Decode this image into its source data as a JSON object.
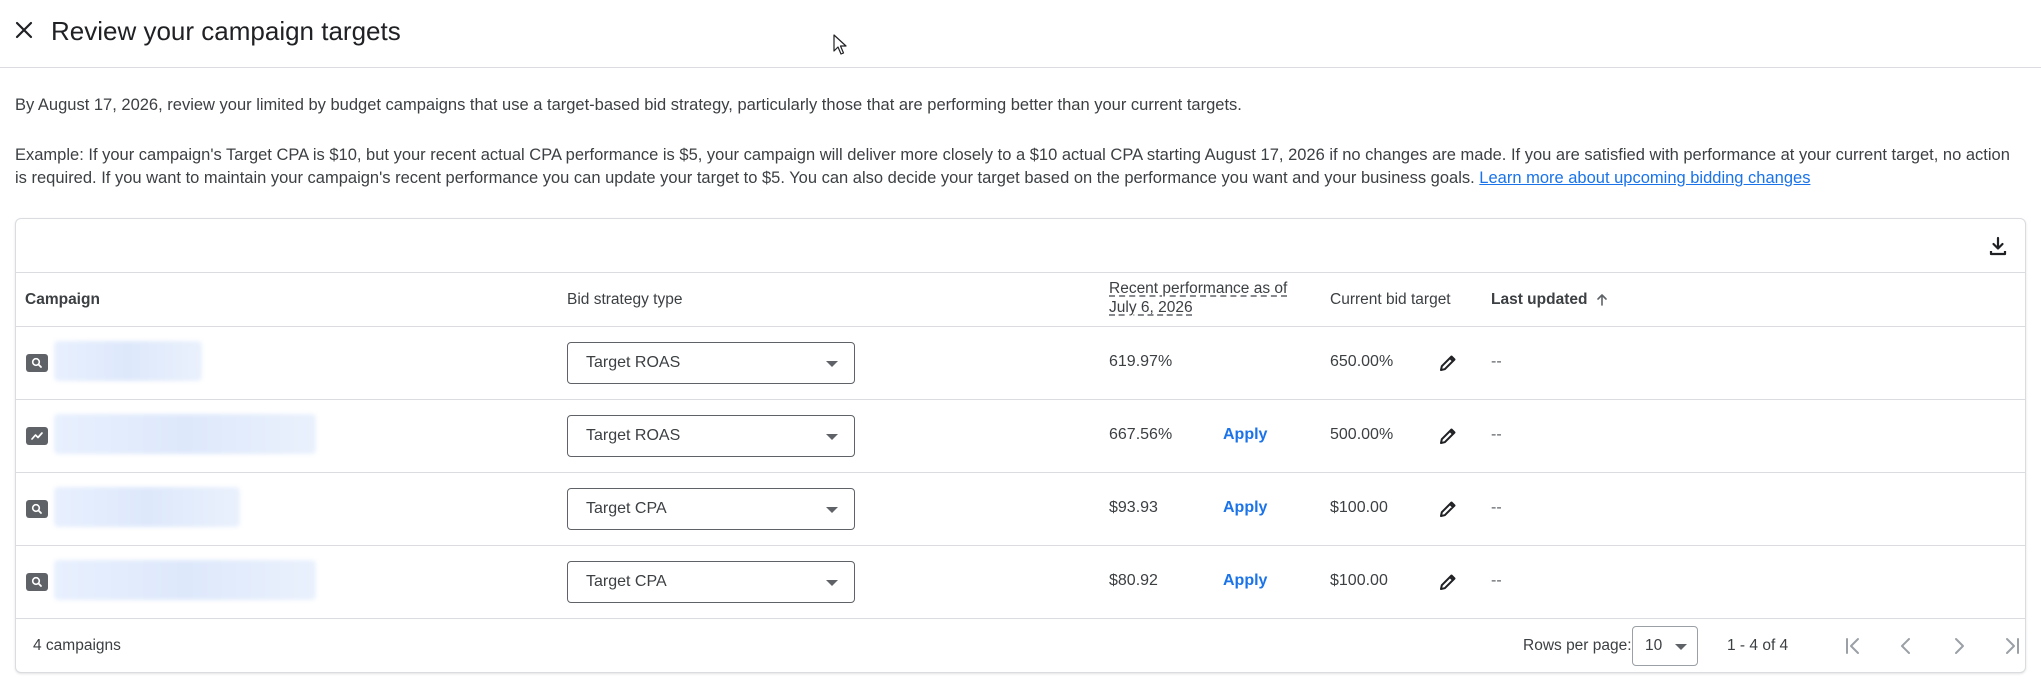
{
  "header": {
    "title": "Review your campaign targets",
    "close_icon": "close-icon"
  },
  "description": {
    "line1": "By August 17, 2026, review your limited by budget campaigns that use a target-based bid strategy, particularly those that are performing better than your current targets.",
    "line2": "Example: If your campaign's Target CPA is $10, but your recent actual CPA performance is $5, your campaign will deliver more closely to a $10 actual CPA starting August 17, 2026 if no changes are made. If you are satisfied with performance at your current target, no action is required. If you want to maintain your campaign's recent performance you can update your target to $5. You can also decide your target based on the performance you want and your business goals.",
    "link": "Learn more about upcoming bidding changes"
  },
  "table": {
    "columns": {
      "campaign": "Campaign",
      "bid_strategy": "Bid strategy type",
      "recent": "Recent performance as of July 6, 2026",
      "current": "Current bid target",
      "last_updated": "Last updated"
    },
    "rows": [
      {
        "type_icon": "search-icon",
        "bid_strategy": "Target ROAS",
        "recent": "619.97%",
        "apply": "",
        "current": "650.00%",
        "last_updated": "--"
      },
      {
        "type_icon": "performance-icon",
        "bid_strategy": "Target ROAS",
        "recent": "667.56%",
        "apply": "Apply",
        "current": "500.00%",
        "last_updated": "--"
      },
      {
        "type_icon": "search-icon",
        "bid_strategy": "Target CPA",
        "recent": "$93.93",
        "apply": "Apply",
        "current": "$100.00",
        "last_updated": "--"
      },
      {
        "type_icon": "search-icon",
        "bid_strategy": "Target CPA",
        "recent": "$80.92",
        "apply": "Apply",
        "current": "$100.00",
        "last_updated": "--"
      }
    ]
  },
  "footer": {
    "count": "4 campaigns",
    "rows_per_page_label": "Rows per page:",
    "rows_per_page_value": "10",
    "range": "1 - 4 of 4"
  },
  "colors": {
    "accent": "#1a73e8",
    "text": "#202124",
    "border": "#dadce0"
  }
}
